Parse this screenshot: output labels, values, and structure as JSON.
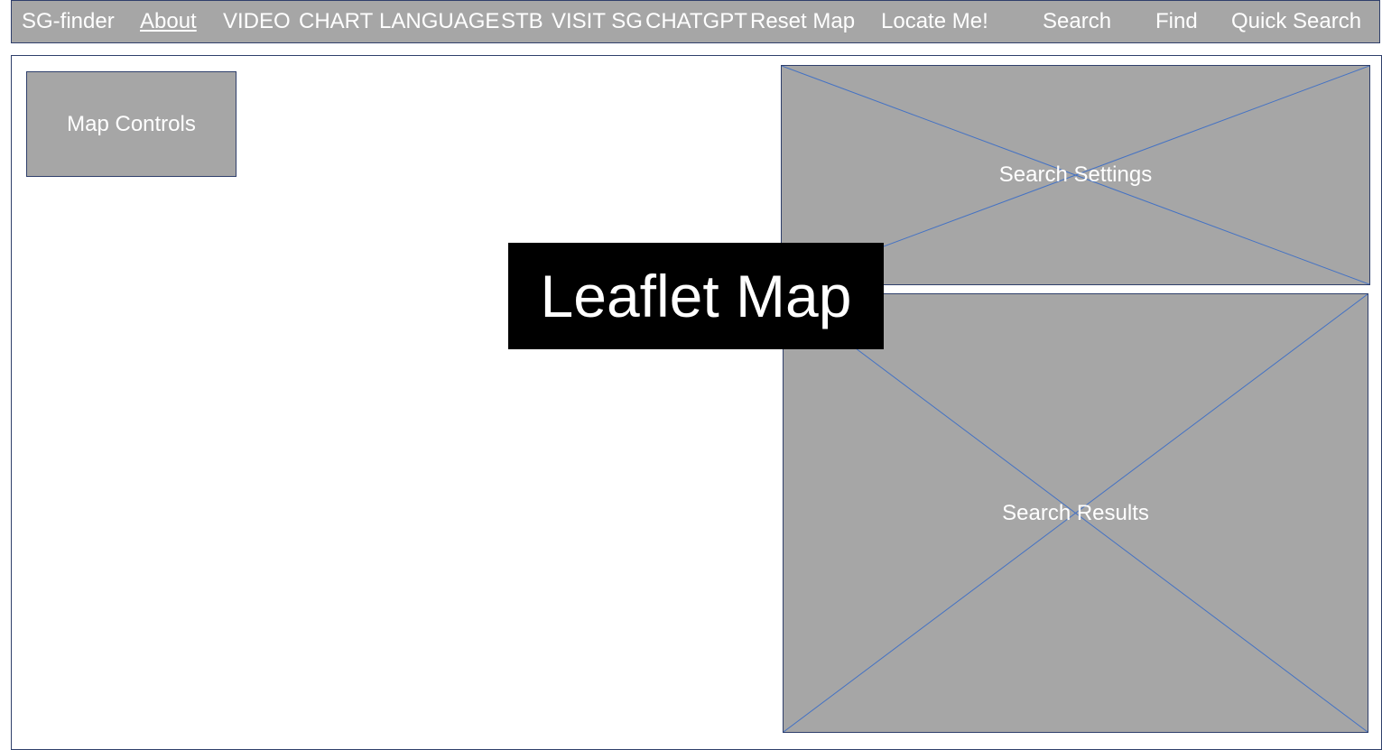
{
  "nav": {
    "items": [
      {
        "label": "SG-finder"
      },
      {
        "label": "About"
      },
      {
        "label": "VIDEO"
      },
      {
        "label": "CHART"
      },
      {
        "label": "LANGUAGE"
      },
      {
        "label": "STB"
      },
      {
        "label": "VISIT SG"
      },
      {
        "label": "CHATGPT"
      },
      {
        "label": "Reset Map"
      },
      {
        "label": "Locate Me!"
      },
      {
        "label": "Search"
      },
      {
        "label": "Find"
      },
      {
        "label": "Quick Search"
      }
    ]
  },
  "map": {
    "label": "Leaflet Map",
    "controls_label": "Map Controls"
  },
  "panels": {
    "settings_label": "Search Settings",
    "results_label": "Search Results"
  },
  "colors": {
    "panel_fill": "#a6a6a6",
    "border": "#2f3f6b",
    "placeholder_cross": "#4472c4",
    "map_label_bg": "#000000",
    "text": "#ffffff"
  }
}
